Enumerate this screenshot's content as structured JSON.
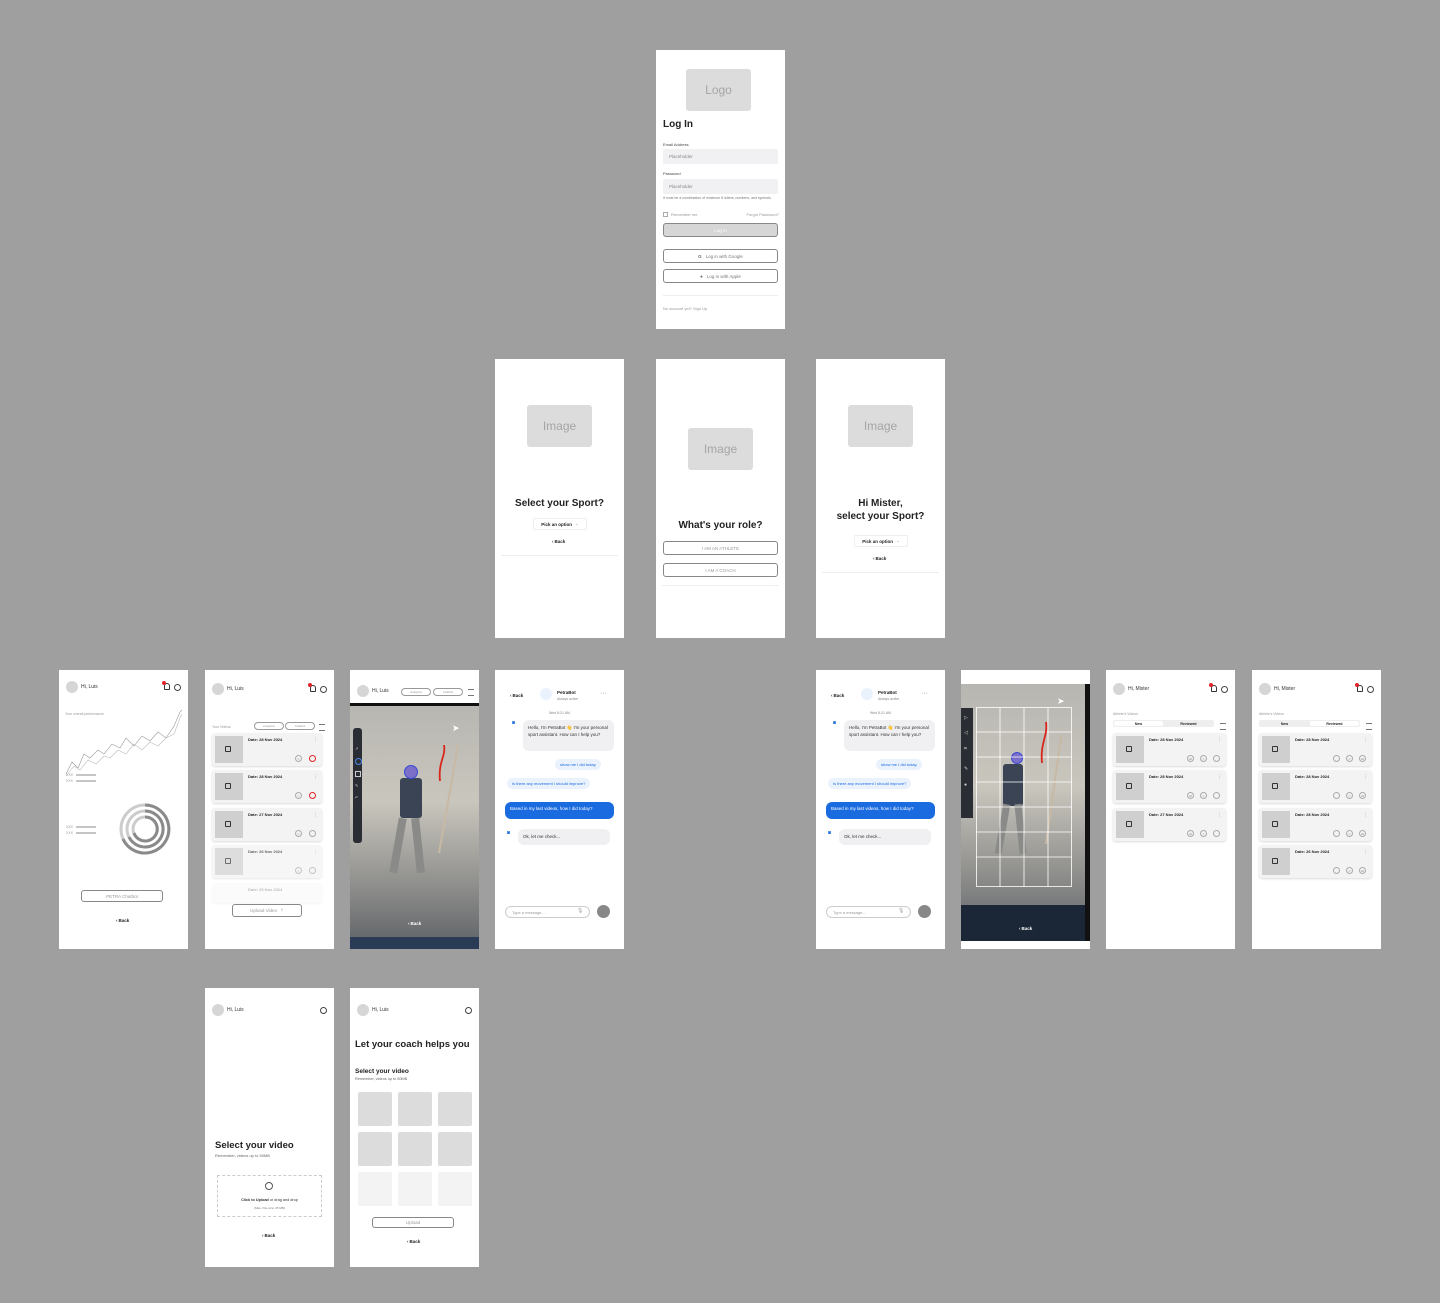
{
  "login": {
    "logo": "Logo",
    "title": "Log In",
    "email_label": "Email Address",
    "email_placeholder": "Placeholder",
    "password_label": "Password",
    "password_placeholder": "Placeholder",
    "password_hint": "It must be a combination of minimum 8 letters, numbers, and symbols.",
    "remember": "Remember me",
    "forgot": "Forgot Password?",
    "login_button": "Log In",
    "google_button": "Log in with Google",
    "apple_button": "Log in with Apple",
    "signup": "No account yet? Sign Up"
  },
  "sport_select": {
    "image": "Image",
    "title": "Select your Sport?",
    "picker": "Pick an option",
    "back": "Back"
  },
  "role_select": {
    "image": "Image",
    "title": "What's your role?",
    "athlete": "I AM AN ATHLETE",
    "coach": "I AM A COACH"
  },
  "coach_sport": {
    "image": "Image",
    "title_line1": "Hi Mister,",
    "title_line2": "select your Sport?",
    "picker": "Pick an option",
    "back": "Back"
  },
  "dashboard": {
    "greeting": "Hi, Luis",
    "perf_label": "Your overall performance",
    "legend_a": "XXX",
    "legend_b": "XXX",
    "legend_c": "XXX",
    "legend_d": "XXX",
    "chatbot_button": "PETRA Chatbot",
    "back": "Back"
  },
  "videos": {
    "greeting": "Hi, Luis",
    "section": "Your Videos",
    "tab_a": "Analytics",
    "tab_b": "Chatbot",
    "cards": [
      {
        "date": "Date: 28 Nov 2024"
      },
      {
        "date": "Date: 28 Nov 2024"
      },
      {
        "date": "Date: 27 Nov 2024"
      },
      {
        "date": "Date: 26 Nov 2024"
      },
      {
        "date": "Date: 25 Nov 2024"
      }
    ],
    "upload_button": "Upload Video"
  },
  "player": {
    "greeting": "Hi, Luis",
    "tab_a": "Analytics",
    "tab_b": "Chatbot",
    "back": "Back"
  },
  "chat": {
    "back": "Back",
    "bot_name": "PetraBot",
    "bot_status": "Always active",
    "timestamp": "Wed 8:21 AM",
    "msg1": "Hello, I'm PetraBot 👋 I'm your personal sport assistant. How can I help you?",
    "sugg1": "show me I did today.",
    "sugg2": "Is there any movement I should improve?",
    "user_msg": "Based in my last videos, how I did today?",
    "bot_reply": "Ok, let me check...",
    "input_placeholder": "Type a message..."
  },
  "coach_list": {
    "greeting": "Hi, Mister",
    "section": "Athlete's Videos",
    "tab_new": "New",
    "tab_reviewed": "Reviewed",
    "cards_a": [
      {
        "date": "Date: 28 Nov 2024"
      },
      {
        "date": "Date: 28 Nov 2024"
      },
      {
        "date": "Date: 27 Nov 2024"
      }
    ],
    "cards_b": [
      {
        "date": "Date: 28 Nov 2024"
      },
      {
        "date": "Date: 28 Nov 2024"
      },
      {
        "date": "Date: 28 Nov 2024"
      },
      {
        "date": "Date: 26 Nov 2024"
      }
    ]
  },
  "coach_player": {
    "back": "Back"
  },
  "upload": {
    "greeting": "Hi, Luis",
    "title": "Select your video",
    "subtitle": "Remember, videos up to 50MB",
    "click": "Click to Upload",
    "drag": " or drag and drop",
    "max": "(Max. File size: 25 MB)",
    "back": "Back"
  },
  "gallery": {
    "greeting": "Hi, Luis",
    "title": "Let your coach helps you",
    "subtitle": "Select your video",
    "note": "Remember, videos up to 50MB",
    "upload_button": "Upload",
    "back": "Back"
  },
  "colors": {
    "background": "#9f9f9f",
    "accent_blue": "#1a6be0",
    "alert_red": "#e0242a"
  },
  "icons": [
    "bell-icon",
    "gear-icon",
    "play-icon",
    "star-icon",
    "ai-icon",
    "comment-icon",
    "filter-icon",
    "mic-icon",
    "send-icon",
    "upload-icon",
    "kebab-icon",
    "chevron-left-icon"
  ]
}
